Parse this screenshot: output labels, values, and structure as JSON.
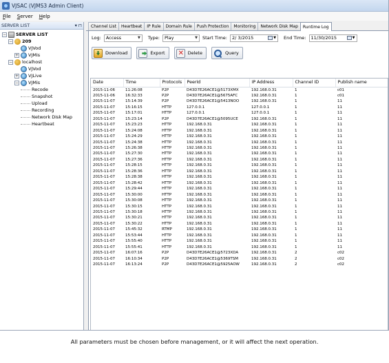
{
  "window": {
    "title": "VJSAC (VJMS3 Admin Client)"
  },
  "menu": [
    "File",
    "Server",
    "Help"
  ],
  "sidebar": {
    "header": "SERVER LIST",
    "pin_label": "▾ ⊓",
    "tree": [
      {
        "label": "SERVER LIST",
        "level": 0,
        "expander": "−",
        "icon": "server",
        "bold": true
      },
      {
        "label": "209",
        "level": 1,
        "expander": "−",
        "icon": "group",
        "bold": true
      },
      {
        "label": "VJVod",
        "level": 2,
        "expander": "",
        "icon": "node"
      },
      {
        "label": "VJMis",
        "level": 2,
        "expander": "+",
        "icon": "node"
      },
      {
        "label": "localhost",
        "level": 1,
        "expander": "−",
        "icon": "group"
      },
      {
        "label": "VJVod",
        "level": 2,
        "expander": "",
        "icon": "node"
      },
      {
        "label": "VJLive",
        "level": 2,
        "expander": "+",
        "icon": "node"
      },
      {
        "label": "VJMis",
        "level": 2,
        "expander": "−",
        "icon": "node"
      },
      {
        "label": "Recode",
        "level": 3,
        "expander": "",
        "icon": ""
      },
      {
        "label": "Snapshot",
        "level": 3,
        "expander": "",
        "icon": ""
      },
      {
        "label": "Upload",
        "level": 3,
        "expander": "",
        "icon": ""
      },
      {
        "label": "Recording",
        "level": 3,
        "expander": "",
        "icon": ""
      },
      {
        "label": "Network Disk Map",
        "level": 3,
        "expander": "",
        "icon": ""
      },
      {
        "label": "Heartbeat",
        "level": 3,
        "expander": "",
        "icon": ""
      }
    ]
  },
  "tabs": [
    "Channel List",
    "Heartbeat",
    "IP Rule",
    "Domain Rule",
    "Push Protection",
    "Monitoring",
    "Network Disk Map",
    "Runtime Log"
  ],
  "active_tab": "Runtime Log",
  "filters": {
    "log_label": "Log:",
    "log_value": "Access",
    "type_label": "Type:",
    "type_value": "Play",
    "start_label": "Start Time:",
    "start_value": "2/ 3/2015",
    "end_label": "End Time:",
    "end_value": "11/30/2015"
  },
  "buttons": {
    "download": "Download",
    "export": "Export",
    "delete": "Delete",
    "query": "Query"
  },
  "table": {
    "columns": [
      "Date",
      "Time",
      "Protocols",
      "PeerId",
      "IP Address",
      "Channel ID",
      "Publish name"
    ],
    "rows": [
      [
        "2015-11-06",
        "11:26:08",
        "P2P",
        "D43D7E26ACE1@5173XMX",
        "192.168.0.31",
        "1",
        "c01"
      ],
      [
        "2015-11-06",
        "16:32:33",
        "P2P",
        "D43D7E26ACE1@5675AFC",
        "192.168.0.31",
        "1",
        "c01"
      ],
      [
        "2015-11-07",
        "15:14:39",
        "P2P",
        "D43D7E26ACE1@5413NOO",
        "192.168.0.31",
        "1",
        "11"
      ],
      [
        "2015-11-07",
        "15:16:15",
        "HTTP",
        "127.0.0.1",
        "127.0.0.1",
        "1",
        "11"
      ],
      [
        "2015-11-07",
        "15:17:01",
        "HTTP",
        "127.0.0.1",
        "127.0.0.1",
        "1",
        "11"
      ],
      [
        "2015-11-07",
        "15:23:14",
        "P2P",
        "D43D7E26ACE1@5095UCE",
        "192.168.0.31",
        "1",
        "11"
      ],
      [
        "2015-11-07",
        "15:23:23",
        "HTTP",
        "192.168.0.31",
        "192.168.0.31",
        "1",
        "11"
      ],
      [
        "2015-11-07",
        "15:24:08",
        "HTTP",
        "192.168.0.31",
        "192.168.0.31",
        "1",
        "11"
      ],
      [
        "2015-11-07",
        "15:24:29",
        "HTTP",
        "192.168.0.31",
        "192.168.0.31",
        "1",
        "11"
      ],
      [
        "2015-11-07",
        "15:24:38",
        "HTTP",
        "192.168.0.31",
        "192.168.0.31",
        "1",
        "11"
      ],
      [
        "2015-11-07",
        "15:26:38",
        "HTTP",
        "192.168.0.31",
        "192.168.0.31",
        "1",
        "11"
      ],
      [
        "2015-11-07",
        "15:27:30",
        "HTTP",
        "192.168.0.31",
        "192.168.0.31",
        "1",
        "11"
      ],
      [
        "2015-11-07",
        "15:27:36",
        "HTTP",
        "192.168.0.31",
        "192.168.0.31",
        "1",
        "11"
      ],
      [
        "2015-11-07",
        "15:28:15",
        "HTTP",
        "192.168.0.31",
        "192.168.0.31",
        "1",
        "11"
      ],
      [
        "2015-11-07",
        "15:28:36",
        "HTTP",
        "192.168.0.31",
        "192.168.0.31",
        "1",
        "11"
      ],
      [
        "2015-11-07",
        "15:28:38",
        "HTTP",
        "192.168.0.31",
        "192.168.0.31",
        "1",
        "11"
      ],
      [
        "2015-11-07",
        "15:28:42",
        "HTTP",
        "192.168.0.31",
        "192.168.0.31",
        "1",
        "11"
      ],
      [
        "2015-11-07",
        "15:29:44",
        "HTTP",
        "192.168.0.31",
        "192.168.0.31",
        "1",
        "11"
      ],
      [
        "2015-11-07",
        "15:30:00",
        "HTTP",
        "192.168.0.31",
        "192.168.0.31",
        "1",
        "11"
      ],
      [
        "2015-11-07",
        "15:30:08",
        "HTTP",
        "192.168.0.31",
        "192.168.0.31",
        "1",
        "11"
      ],
      [
        "2015-11-07",
        "15:30:15",
        "HTTP",
        "192.168.0.31",
        "192.168.0.31",
        "1",
        "11"
      ],
      [
        "2015-11-07",
        "15:30:18",
        "HTTP",
        "192.168.0.31",
        "192.168.0.31",
        "1",
        "11"
      ],
      [
        "2015-11-07",
        "15:30:21",
        "HTTP",
        "192.168.0.31",
        "192.168.0.31",
        "1",
        "11"
      ],
      [
        "2015-11-07",
        "15:30:22",
        "HTTP",
        "192.168.0.31",
        "192.168.0.31",
        "1",
        "11"
      ],
      [
        "2015-11-07",
        "15:45:32",
        "RTMP",
        "192.168.0.31",
        "192.168.0.31",
        "1",
        "11"
      ],
      [
        "2015-11-07",
        "15:53:44",
        "HTTP",
        "192.168.0.31",
        "192.168.0.31",
        "1",
        "11"
      ],
      [
        "2015-11-07",
        "15:55:40",
        "HTTP",
        "192.168.0.31",
        "192.168.0.31",
        "1",
        "11"
      ],
      [
        "2015-11-07",
        "15:55:41",
        "HTTP",
        "192.168.0.31",
        "192.168.0.31",
        "1",
        "11"
      ],
      [
        "2015-11-07",
        "16:07:16",
        "P2P",
        "D43D7E26ACE1@5723XDA",
        "192.168.0.31",
        "2",
        "c02"
      ],
      [
        "2015-11-07",
        "16:10:34",
        "P2P",
        "D43D7E26ACE1@5369TSM",
        "192.168.0.31",
        "2",
        "c02"
      ],
      [
        "2015-11-07",
        "16:13:24",
        "P2P",
        "D43D7E26ACE1@5925AOW",
        "192.168.0.31",
        "2",
        "c02"
      ]
    ]
  },
  "caption": "All parameters must be chosen before management, or it will affect the next operation."
}
